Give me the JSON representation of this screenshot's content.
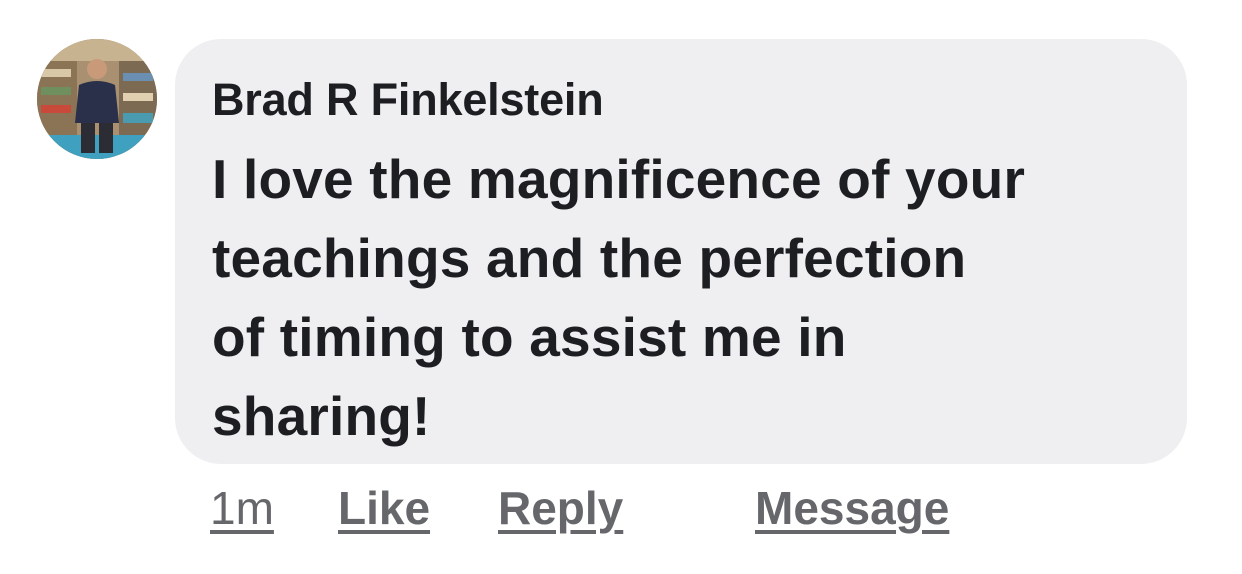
{
  "comment": {
    "author": "Brad R Finkelstein",
    "text": "I love the magnificence of your\nteachings and the perfection\nof timing to assist me in\nsharing!",
    "avatar_icon": "profile-photo-avatar",
    "bubble_color": "#efeff2",
    "text_color": "#1c1e21"
  },
  "actions": {
    "time": "1m",
    "like": "Like",
    "reply": "Reply",
    "message": "Message",
    "color": "#65676b"
  }
}
